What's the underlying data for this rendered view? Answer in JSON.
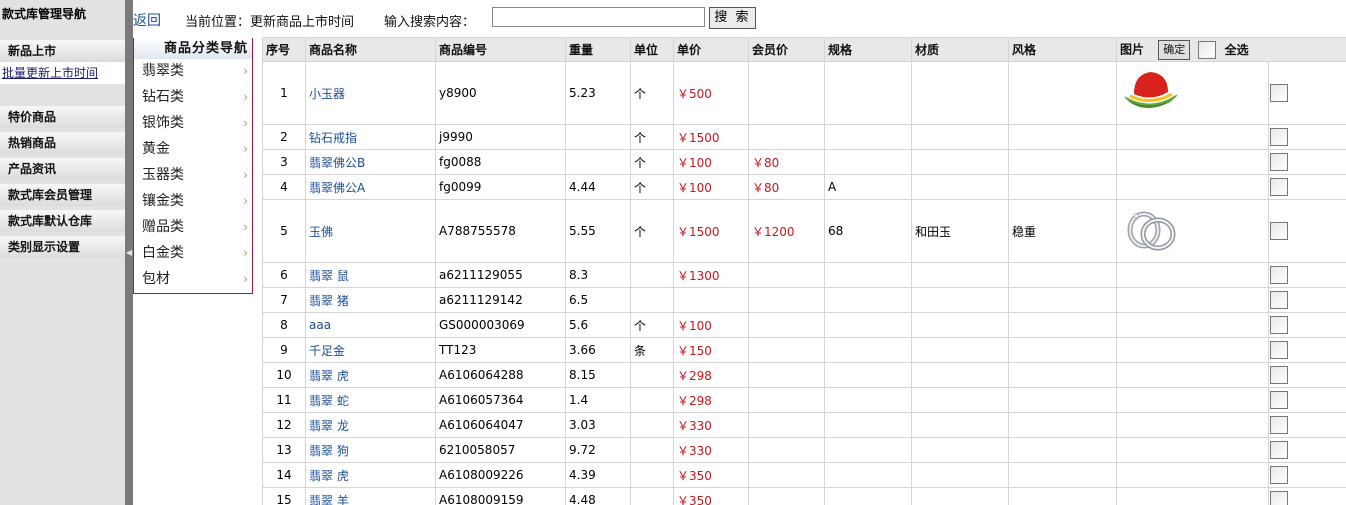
{
  "leftnav": {
    "title": "款式库管理导航",
    "items": [
      {
        "label": "新品上市"
      },
      {
        "label": "批量更新上市时间"
      },
      {
        "label": "特价商品"
      },
      {
        "label": "热销商品"
      },
      {
        "label": "产品资讯"
      },
      {
        "label": "款式库会员管理"
      },
      {
        "label": "款式库默认仓库"
      },
      {
        "label": "类别显示设置"
      }
    ]
  },
  "topbar": {
    "back": "返回",
    "breadcrumb": "当前位置：更新商品上市时间",
    "search_label": "输入搜索内容：",
    "search_value": "",
    "search_button": "搜 索"
  },
  "categories": {
    "title": "商品分类导航",
    "items": [
      "翡翠类",
      "钻石类",
      "银饰类",
      "黄金",
      "玉器类",
      "镶金类",
      "赠品类",
      "白金类",
      "包材"
    ],
    "chevron": "›"
  },
  "table": {
    "headers": [
      "序号",
      "商品名称",
      "商品编号",
      "重量",
      "单位",
      "单价",
      "会员价",
      "规格",
      "材质",
      "风格",
      "图片"
    ],
    "confirm_button": "确定",
    "select_all": "全选",
    "rows": [
      {
        "idx": "1",
        "name": "小玉器",
        "code": "y8900",
        "weight": "5.23",
        "unit": "个",
        "price": "￥500",
        "vip": "",
        "spec": "",
        "material": "",
        "style": "",
        "image": "hat-logo-image"
      },
      {
        "idx": "2",
        "name": "钻石戒指",
        "code": "j9990",
        "weight": "",
        "unit": "个",
        "price": "￥1500",
        "vip": "",
        "spec": "",
        "material": "",
        "style": "",
        "image": ""
      },
      {
        "idx": "3",
        "name": "翡翠佛公B",
        "code": "fg0088",
        "weight": "",
        "unit": "个",
        "price": "￥100",
        "vip": "￥80",
        "spec": "",
        "material": "",
        "style": "",
        "image": ""
      },
      {
        "idx": "4",
        "name": "翡翠佛公A",
        "code": "fg0099",
        "weight": "4.44",
        "unit": "个",
        "price": "￥100",
        "vip": "￥80",
        "spec": "A",
        "material": "",
        "style": "",
        "image": ""
      },
      {
        "idx": "5",
        "name": "玉佛",
        "code": "A788755578",
        "weight": "5.55",
        "unit": "个",
        "price": "￥1500",
        "vip": "￥1200",
        "spec": "68",
        "material": "和田玉",
        "style": "稳重",
        "image": "rings-image"
      },
      {
        "idx": "6",
        "name": "翡翠 鼠",
        "code": "a6211129055",
        "weight": "8.3",
        "unit": "",
        "price": "￥1300",
        "vip": "",
        "spec": "",
        "material": "",
        "style": "",
        "image": ""
      },
      {
        "idx": "7",
        "name": "翡翠 猪",
        "code": "a6211129142",
        "weight": "6.5",
        "unit": "",
        "price": "",
        "vip": "",
        "spec": "",
        "material": "",
        "style": "",
        "image": ""
      },
      {
        "idx": "8",
        "name": "aaa",
        "code": "GS000003069",
        "weight": "5.6",
        "unit": "个",
        "price": "￥100",
        "vip": "",
        "spec": "",
        "material": "",
        "style": "",
        "image": ""
      },
      {
        "idx": "9",
        "name": "千足金",
        "code": "TT123",
        "weight": "3.66",
        "unit": "条",
        "price": "￥150",
        "vip": "",
        "spec": "",
        "material": "",
        "style": "",
        "image": ""
      },
      {
        "idx": "10",
        "name": "翡翠 虎",
        "code": "A6106064288",
        "weight": "8.15",
        "unit": "",
        "price": "￥298",
        "vip": "",
        "spec": "",
        "material": "",
        "style": "",
        "image": ""
      },
      {
        "idx": "11",
        "name": "翡翠 蛇",
        "code": "A6106057364",
        "weight": "1.4",
        "unit": "",
        "price": "￥298",
        "vip": "",
        "spec": "",
        "material": "",
        "style": "",
        "image": ""
      },
      {
        "idx": "12",
        "name": "翡翠 龙",
        "code": "A6106064047",
        "weight": "3.03",
        "unit": "",
        "price": "￥330",
        "vip": "",
        "spec": "",
        "material": "",
        "style": "",
        "image": ""
      },
      {
        "idx": "13",
        "name": "翡翠 狗",
        "code": "6210058057",
        "weight": "9.72",
        "unit": "",
        "price": "￥330",
        "vip": "",
        "spec": "",
        "material": "",
        "style": "",
        "image": ""
      },
      {
        "idx": "14",
        "name": "翡翠 虎",
        "code": "A6108009226",
        "weight": "4.39",
        "unit": "",
        "price": "￥350",
        "vip": "",
        "spec": "",
        "material": "",
        "style": "",
        "image": ""
      },
      {
        "idx": "15",
        "name": "翡翠 羊",
        "code": "A6108009159",
        "weight": "4.48",
        "unit": "",
        "price": "￥350",
        "vip": "",
        "spec": "",
        "material": "",
        "style": "",
        "image": ""
      }
    ]
  }
}
